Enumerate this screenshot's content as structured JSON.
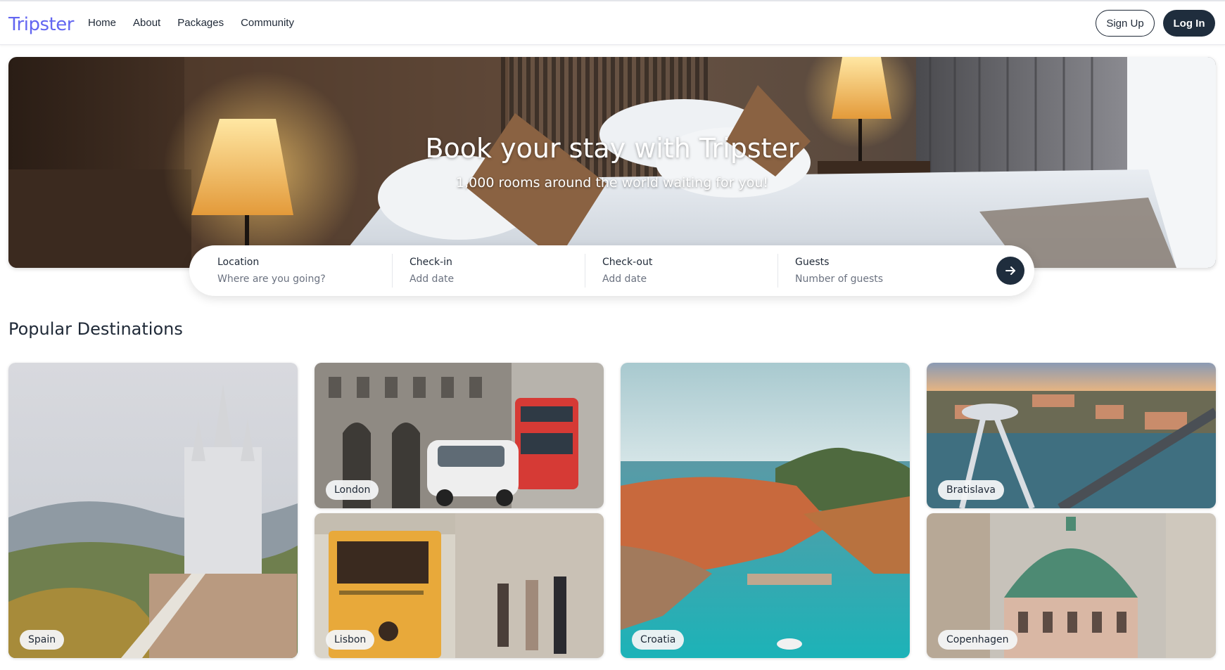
{
  "brand": {
    "logo": "Tripster",
    "accent": "#6366f1"
  },
  "nav": {
    "links": [
      "Home",
      "About",
      "Packages",
      "Community"
    ],
    "signup": "Sign Up",
    "login": "Log In"
  },
  "hero": {
    "title": "Book your stay with Tripster",
    "subtitle": "1,000 rooms around the world waiting for you!"
  },
  "search": {
    "location": {
      "label": "Location",
      "placeholder": "Where are you going?"
    },
    "checkin": {
      "label": "Check-in",
      "placeholder": "Add date"
    },
    "checkout": {
      "label": "Check-out",
      "placeholder": "Add date"
    },
    "guests": {
      "label": "Guests",
      "placeholder": "Number of guests"
    },
    "submit_icon": "arrow-right-icon"
  },
  "popular": {
    "title": "Popular Destinations",
    "destinations": [
      "Spain",
      "London",
      "Lisbon",
      "Croatia",
      "Bratislava",
      "Copenhagen"
    ]
  },
  "colors": {
    "primary_dark": "#1f2d3d",
    "text": "#1f2937",
    "muted": "#6b7280"
  }
}
